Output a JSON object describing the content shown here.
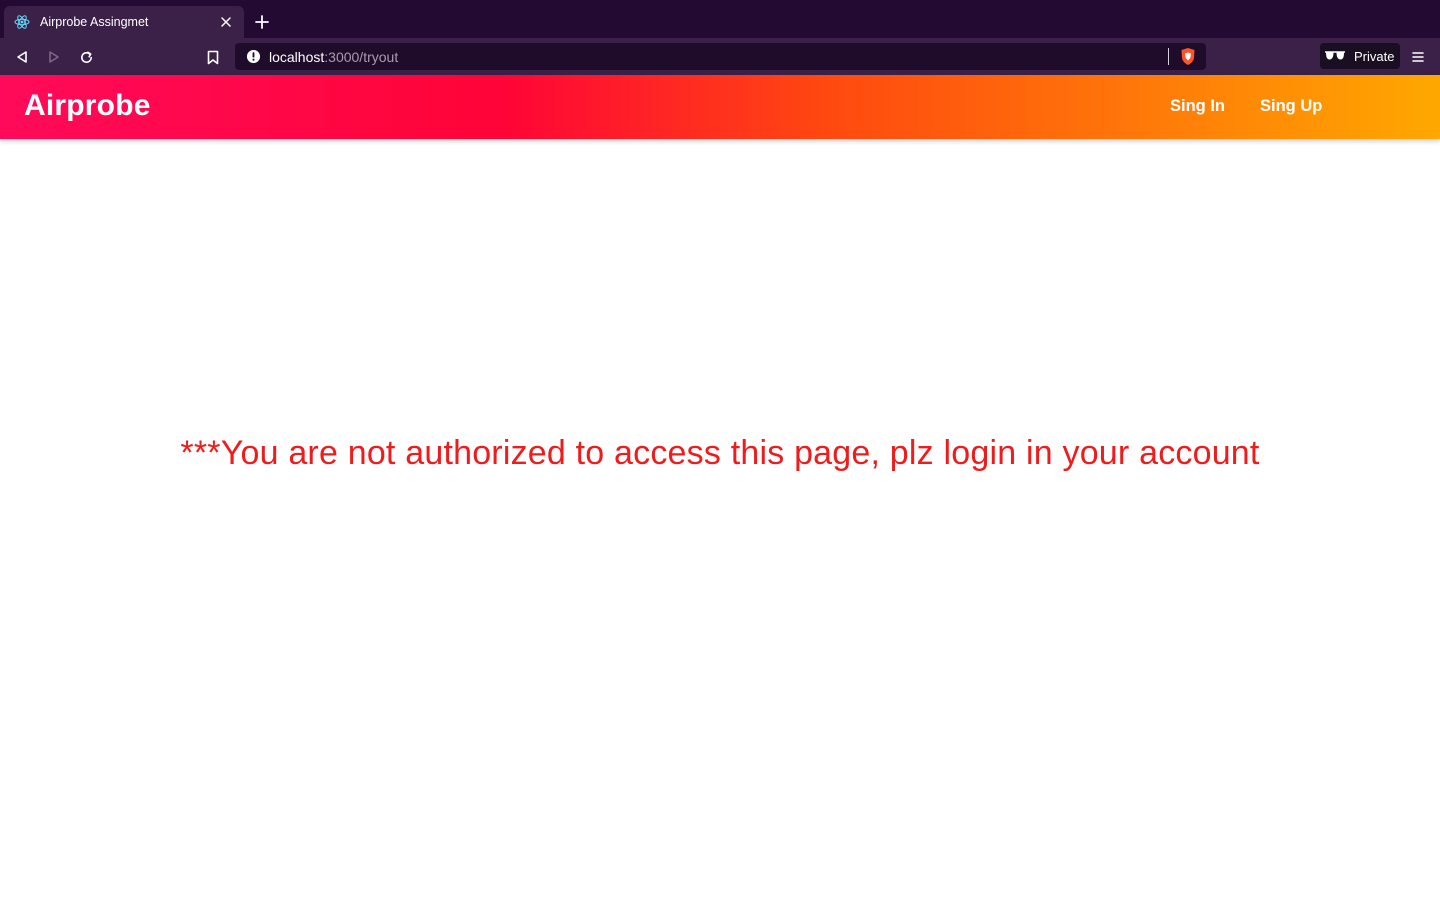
{
  "browser": {
    "tab": {
      "title": "Airprobe Assingmet",
      "favicon": "react-atom-icon",
      "close_symbol": "×"
    },
    "new_tab_symbol": "+",
    "url": {
      "host": "localhost",
      "path": ":3000/tryout"
    },
    "private_label": "Private",
    "colors": {
      "tabstrip": "#220a33",
      "toolbar": "#3b2147"
    }
  },
  "header": {
    "brand": "Airprobe",
    "nav": {
      "signin": "Sing In",
      "signup": "Sing Up"
    },
    "gradient": [
      "#ff0a5a",
      "#ff0437",
      "#ff4a0f",
      "#ff7a09",
      "#ffa800"
    ]
  },
  "main": {
    "message": "***You are not authorized to access this page, plz login in your account",
    "message_color": "#ee1c1c"
  }
}
